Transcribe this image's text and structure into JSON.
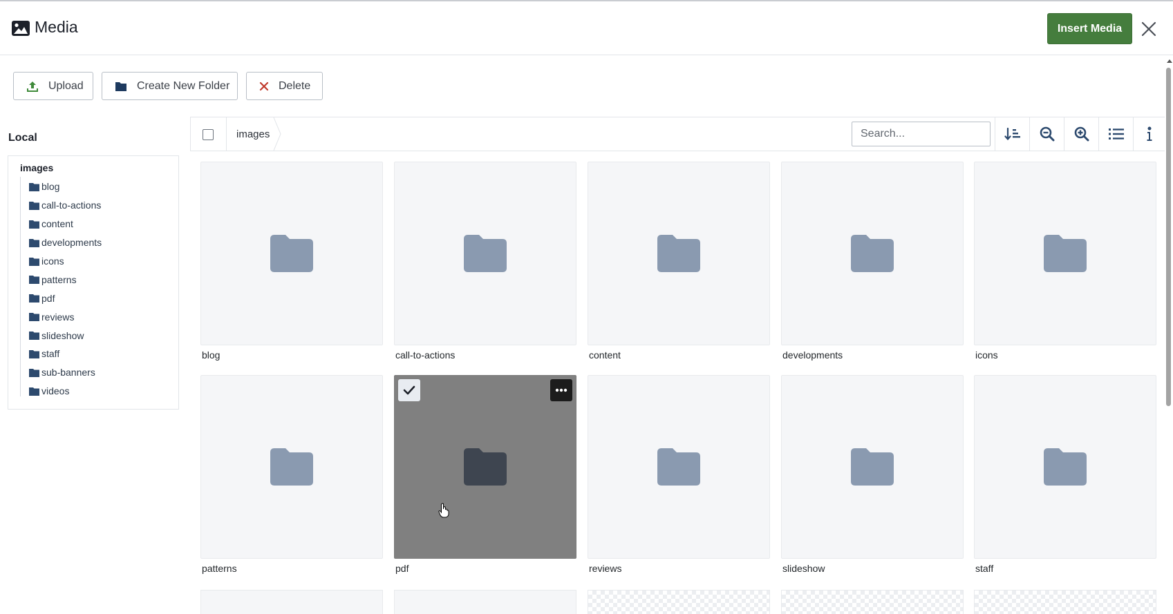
{
  "header": {
    "title": "Media",
    "insert_label": "Insert Media",
    "accent": "#457d3d"
  },
  "toolbar": {
    "upload_label": "Upload",
    "new_folder_label": "Create New Folder",
    "delete_label": "Delete"
  },
  "sidebar": {
    "heading": "Local",
    "root": "images",
    "folders": [
      "blog",
      "call-to-actions",
      "content",
      "developments",
      "icons",
      "patterns",
      "pdf",
      "reviews",
      "slideshow",
      "staff",
      "sub-banners",
      "videos"
    ]
  },
  "browser": {
    "breadcrumb": "images",
    "search_placeholder": "Search...",
    "items": [
      {
        "label": "blog"
      },
      {
        "label": "call-to-actions"
      },
      {
        "label": "content"
      },
      {
        "label": "developments"
      },
      {
        "label": "icons"
      },
      {
        "label": "patterns"
      },
      {
        "label": "pdf",
        "selected": true
      },
      {
        "label": "reviews"
      },
      {
        "label": "slideshow"
      },
      {
        "label": "staff"
      }
    ]
  }
}
